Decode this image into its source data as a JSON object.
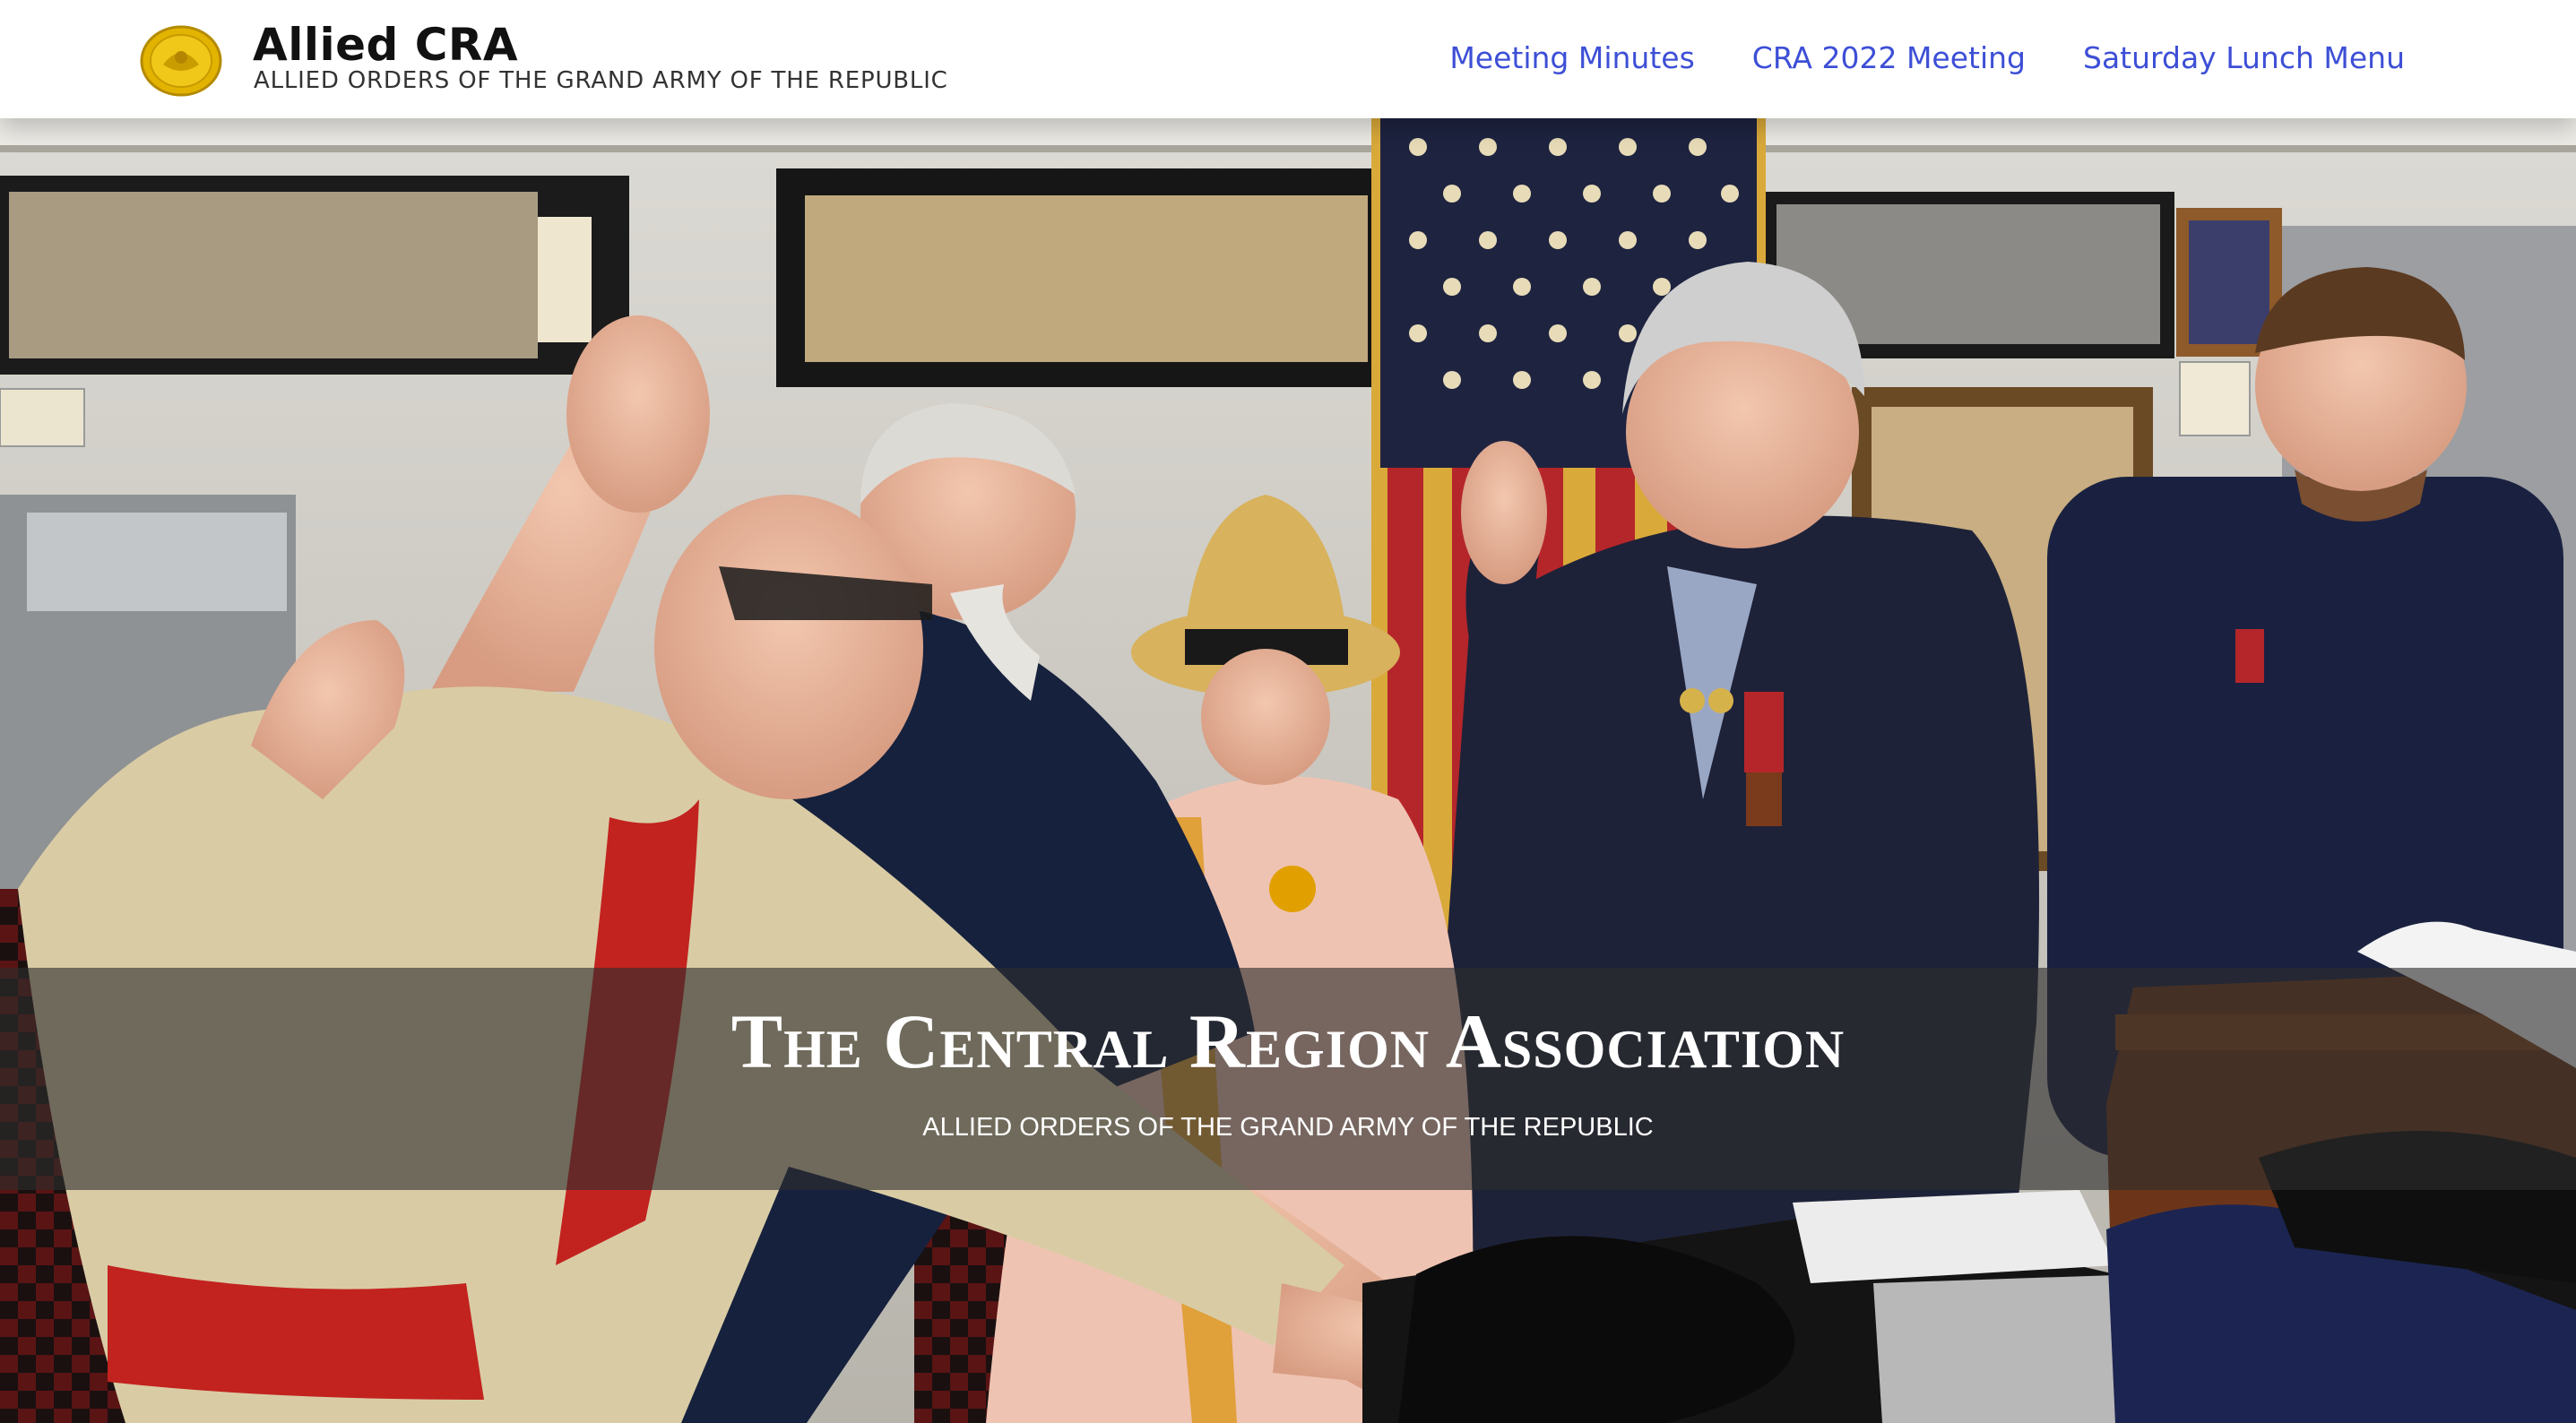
{
  "header": {
    "brand_title": "Allied CRA",
    "brand_subtitle": "ALLIED ORDERS OF THE GRAND ARMY OF THE REPUBLIC",
    "logo_icon": "gold-seal-icon"
  },
  "nav": {
    "items": [
      {
        "label": "Meeting Minutes"
      },
      {
        "label": "CRA 2022 Meeting"
      },
      {
        "label": "Saturday Lunch Menu"
      }
    ]
  },
  "hero": {
    "title": "The Central Region Association",
    "subtitle": "ALLIED ORDERS OF THE GRAND ARMY OF THE REPUBLIC"
  },
  "colors": {
    "nav_link": "#3d4fd6",
    "overlay": "#2d2d2d",
    "flag_blue": "#1e2340",
    "flag_red": "#b5262a",
    "flag_gold": "#d9a93a"
  }
}
